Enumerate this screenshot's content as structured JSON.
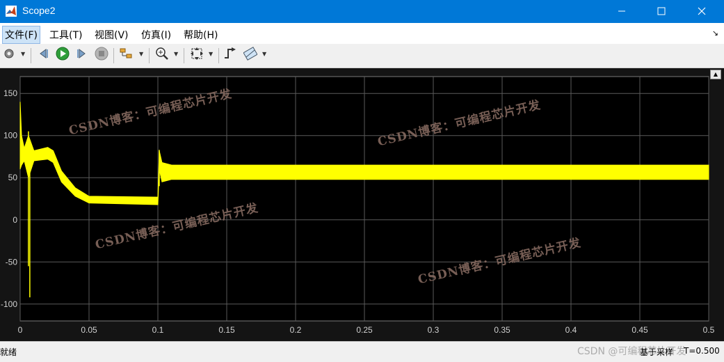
{
  "window": {
    "title": "Scope2"
  },
  "menu": [
    {
      "label": "文件(F)",
      "active": true
    },
    {
      "label": "工具(T)"
    },
    {
      "label": "视图(V)"
    },
    {
      "label": "仿真(I)"
    },
    {
      "label": "帮助(H)"
    }
  ],
  "toolbar": {
    "buttons": [
      "settings",
      "step-back",
      "run",
      "step-forward",
      "stop",
      "signal-selector",
      "zoom",
      "autoscale",
      "triggers",
      "measurements"
    ]
  },
  "watermarks": [
    "CSDN博客：可编程芯片开发",
    "CSDN博客：可编程芯片开发",
    "CSDN博客：可编程芯片开发",
    "CSDN博客：可编程芯片开发"
  ],
  "status": {
    "left": "就绪",
    "sample": "基于采样",
    "time": "T=0.500",
    "credit": "CSDN @可编程芯片开发"
  },
  "colors": {
    "titlebar": "#0078d7",
    "plot_bg": "#000000",
    "signal": "#ffff00",
    "grid": "#5a5a5a"
  },
  "chart_data": {
    "type": "line",
    "xlim": [
      0,
      0.5
    ],
    "ylim": [
      -120,
      170
    ],
    "xticks": [
      "0",
      "0.05",
      "0.1",
      "0.15",
      "0.2",
      "0.25",
      "0.3",
      "0.35",
      "0.4",
      "0.45",
      "0.5"
    ],
    "xtick_values": [
      0,
      0.05,
      0.1,
      0.15,
      0.2,
      0.25,
      0.3,
      0.35,
      0.4,
      0.45,
      0.5
    ],
    "yticks": [
      "150",
      "100",
      "50",
      "0",
      "-50",
      "-100"
    ],
    "ytick_values": [
      150,
      100,
      50,
      0,
      -50,
      -100
    ],
    "grid": true,
    "series": [
      {
        "color": "#ffff00",
        "envelope": [
          {
            "x": 0.0,
            "lo": 60,
            "hi": 140
          },
          {
            "x": 0.001,
            "lo": 65,
            "hi": 100
          },
          {
            "x": 0.003,
            "lo": 70,
            "hi": 85
          },
          {
            "x": 0.006,
            "lo": 50,
            "hi": 100
          },
          {
            "x": 0.01,
            "lo": 70,
            "hi": 82
          },
          {
            "x": 0.02,
            "lo": 72,
            "hi": 86
          },
          {
            "x": 0.024,
            "lo": 68,
            "hi": 82
          },
          {
            "x": 0.03,
            "lo": 45,
            "hi": 58
          },
          {
            "x": 0.04,
            "lo": 28,
            "hi": 38
          },
          {
            "x": 0.05,
            "lo": 20,
            "hi": 28
          },
          {
            "x": 0.1,
            "lo": 18,
            "hi": 27
          },
          {
            "x": 0.101,
            "lo": 60,
            "hi": 82
          },
          {
            "x": 0.103,
            "lo": 45,
            "hi": 68
          },
          {
            "x": 0.11,
            "lo": 48,
            "hi": 65
          },
          {
            "x": 0.5,
            "lo": 48,
            "hi": 65
          }
        ],
        "spikes": [
          {
            "x": 0.006,
            "lo": -55,
            "hi": 105
          },
          {
            "x": 0.007,
            "lo": -92,
            "hi": 60
          },
          {
            "x": 0.101,
            "lo": 40,
            "hi": 83
          }
        ]
      }
    ]
  }
}
